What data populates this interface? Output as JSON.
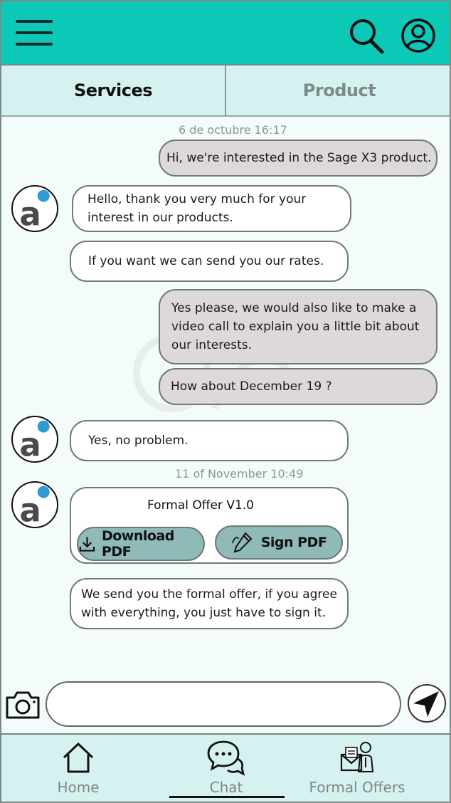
{
  "header": {
    "menu_icon": "hamburger-menu-icon",
    "search_icon": "search-icon",
    "profile_icon": "user-circle-icon",
    "bg_color": "#0cc8b7"
  },
  "tabs": [
    {
      "label": "Services",
      "active": true
    },
    {
      "label": "Product",
      "active": false
    }
  ],
  "chat": {
    "timestamps": [
      "6 de octubre 16:17",
      "11 of November 10:49"
    ],
    "messages": [
      {
        "from": "user",
        "text": "Hi, we're interested in the Sage X3 product."
      },
      {
        "from": "agent",
        "text": "Hello, thank you very much for your interest in our products."
      },
      {
        "from": "agent",
        "text": "If you want we can send you our rates."
      },
      {
        "from": "user",
        "text": "Yes please, we would also like to make a video call to explain you a little bit about our interests."
      },
      {
        "from": "user",
        "text": "How about December 19 ?"
      },
      {
        "from": "agent",
        "text": "Yes, no problem."
      },
      {
        "from": "agent",
        "text": "We send you the formal offer, if you agree with everything, you just have to sign it."
      }
    ],
    "offer": {
      "title": "Formal Offer V1.0",
      "download_label": "Download PDF",
      "sign_label": "Sign PDF"
    }
  },
  "composer": {
    "placeholder": "",
    "camera_icon": "camera-icon",
    "send_icon": "send-arrow-icon"
  },
  "bottom_nav": [
    {
      "label": "Home",
      "icon": "home-icon",
      "active": false
    },
    {
      "label": "Chat",
      "icon": "chat-bubbles-icon",
      "active": true
    },
    {
      "label": "Formal Offers",
      "icon": "formal-offers-icon",
      "active": false
    }
  ]
}
